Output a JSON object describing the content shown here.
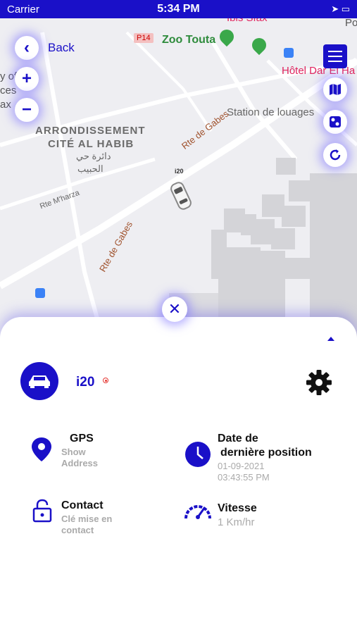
{
  "status_bar": {
    "carrier": "Carrier",
    "time": "5:34 PM"
  },
  "map": {
    "labels": {
      "district_line1": "ARRONDISSEMENT",
      "district_line2": "CITÉ AL HABIB",
      "arabic_line1": "دائرة حي",
      "arabic_line2": "الحبيب",
      "zoo": "Zoo Touta",
      "hotel": "Hôtel Dar El Ha",
      "station": "Station de louages",
      "ibis": "Ibis Sfax",
      "road1": "Rte de Gabes",
      "road2": "Rte de Gabes",
      "road3": "Rte M'harza",
      "p14": "P14",
      "partial1": "y of",
      "partial2": "ces",
      "partial3": "ax",
      "partial4": "Po",
      "car_tag": "i20"
    },
    "back_label": "Back"
  },
  "vehicle": {
    "name": "i20",
    "gps_title": "GPS",
    "gps_sub_line1": "Show",
    "gps_sub_line2": "Address",
    "date_title_line1": "Date de",
    "date_title_line2": "dernière position",
    "date_value": "01-09-2021",
    "time_value": "03:43:55 PM",
    "contact_title": "Contact",
    "contact_sub_line1": "Clé mise en",
    "contact_sub_line2": "contact",
    "speed_title": "Vitesse",
    "speed_value": "1 Km/hr"
  },
  "colors": {
    "accent": "#1a10c8",
    "status_dot": "#e53935"
  }
}
